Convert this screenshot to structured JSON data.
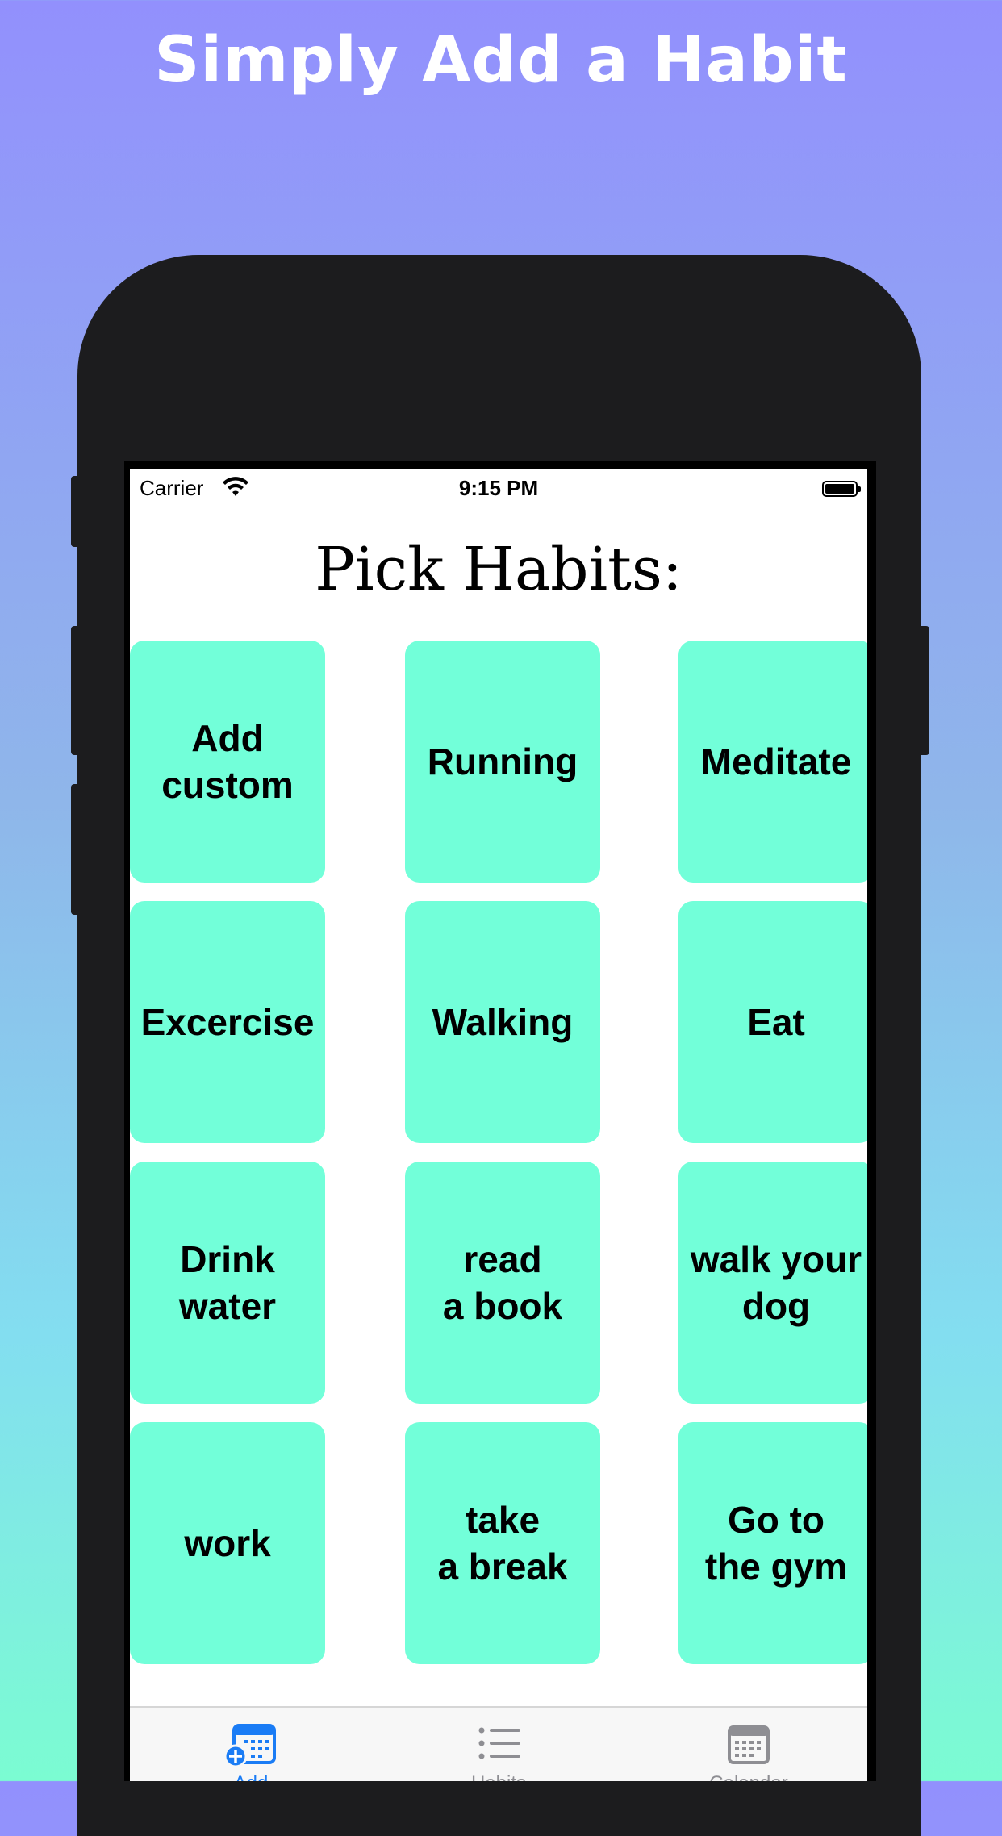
{
  "headline": "Simply Add a Habit",
  "status_bar": {
    "carrier": "Carrier",
    "time": "9:15 PM"
  },
  "page_title": "Pick Habits:",
  "habits": [
    {
      "label": "Add\ncustom"
    },
    {
      "label": "Running"
    },
    {
      "label": "Meditate"
    },
    {
      "label": "Excercise"
    },
    {
      "label": "Walking"
    },
    {
      "label": "Eat"
    },
    {
      "label": "Drink\nwater"
    },
    {
      "label": "read\na book"
    },
    {
      "label": "walk your\ndog"
    },
    {
      "label": "work"
    },
    {
      "label": "take\na break"
    },
    {
      "label": "Go to\nthe gym"
    }
  ],
  "tab_bar": {
    "items": [
      {
        "label": "Add",
        "icon": "calendar-add-icon",
        "active": true
      },
      {
        "label": "Habits",
        "icon": "list-icon",
        "active": false
      },
      {
        "label": "Calendar",
        "icon": "calendar-icon",
        "active": false
      }
    ]
  },
  "colors": {
    "card": "#72ffd9",
    "accent": "#1a7cf5",
    "inactive": "#8e8e93"
  }
}
